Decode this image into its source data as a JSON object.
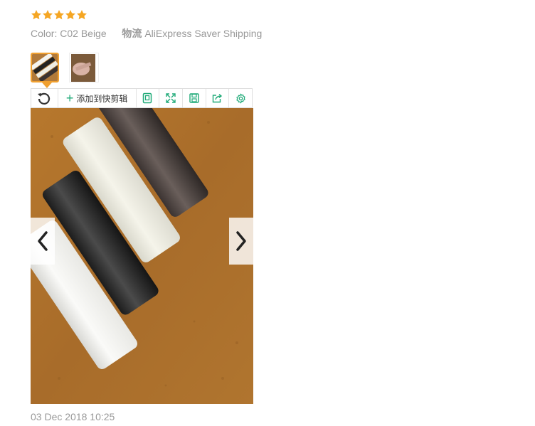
{
  "review": {
    "rating": 5,
    "color_label": "Color:",
    "color_value": "C02 Beige",
    "logistics_label": "物流",
    "logistics_value": "AliExpress Saver Shipping",
    "date": "03 Dec 2018 10:25"
  },
  "thumbnails": [
    {
      "name": "thumbnail-1",
      "selected": true
    },
    {
      "name": "thumbnail-2",
      "selected": false
    }
  ],
  "toolbar": {
    "add_clip_label": "添加到快剪辑",
    "icons": [
      "rotate-icon",
      "plus-icon",
      "copy-icon",
      "fullscreen-icon",
      "save-icon",
      "share-icon",
      "settings-icon"
    ]
  },
  "colors": {
    "star": "#f5a623",
    "thumb_border": "#f0a030",
    "toolbar_icon": "#1faa78",
    "muted_text": "#999999"
  }
}
